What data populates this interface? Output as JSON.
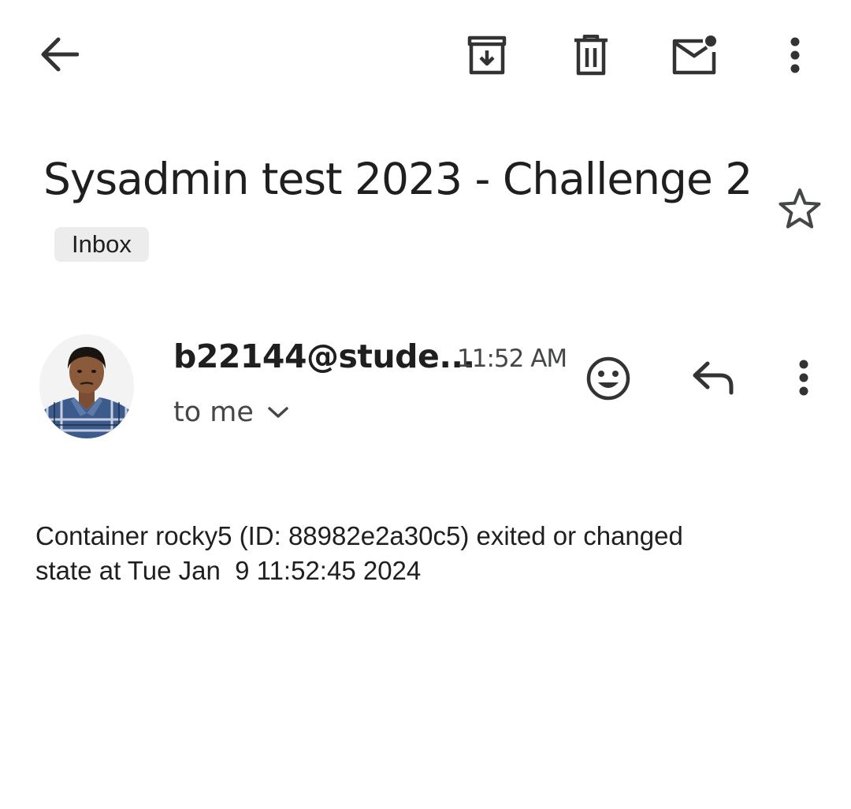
{
  "toolbar": {
    "back_icon": "arrow-left-icon",
    "archive_icon": "archive-icon",
    "delete_icon": "trash-icon",
    "mark_unread_icon": "mail-unread-icon",
    "more_icon": "more-vert-icon"
  },
  "email": {
    "subject": "Sysadmin test 2023 - Challenge 2",
    "label": "Inbox",
    "starred": false,
    "sender": "b22144@stude...",
    "time": "11:52 AM",
    "recipient": "to me",
    "body": "Container rocky5 (ID: 88982e2a30c5) exited or changed\nstate at Tue Jan  9 11:52:45 2024"
  },
  "actions": {
    "react_icon": "emoji-icon",
    "reply_icon": "reply-icon",
    "more_icon": "more-vert-icon"
  },
  "colors": {
    "text_primary": "#1f1f1f",
    "text_secondary": "#444746",
    "icon": "#333333",
    "chip_bg": "#ececec"
  }
}
